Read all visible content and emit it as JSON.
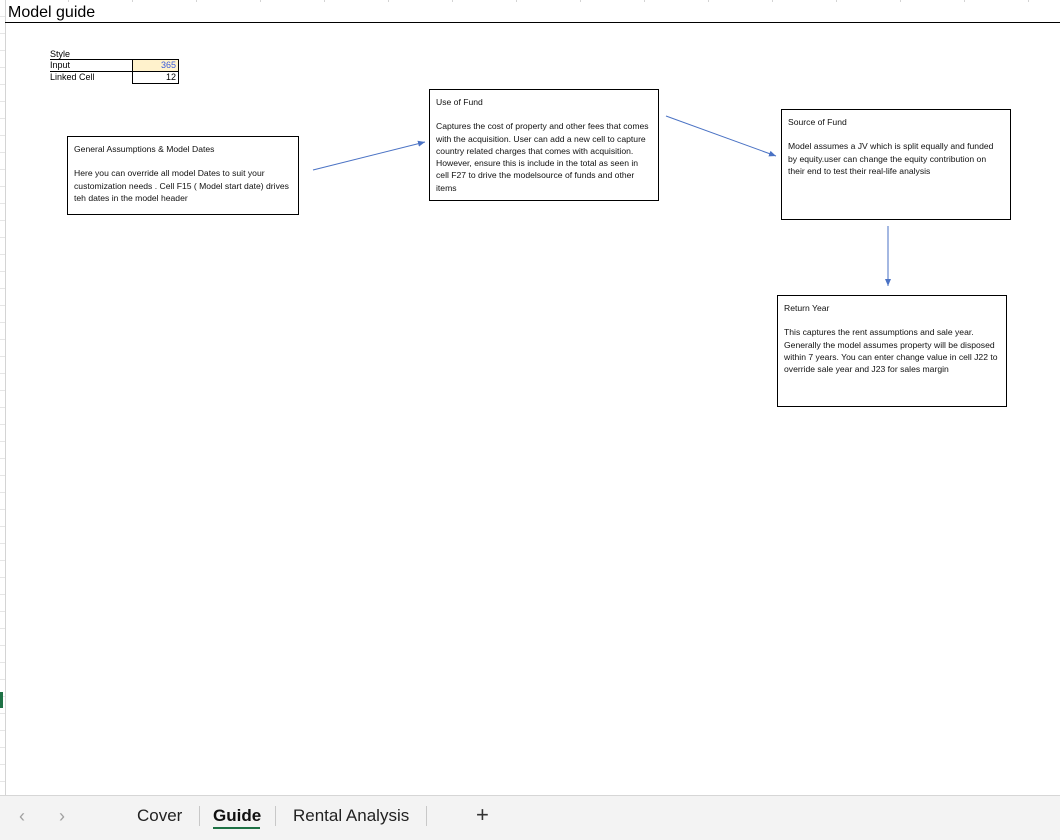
{
  "sheet_title": "Model guide",
  "style_block": {
    "heading": "Style",
    "rows": [
      {
        "label": "Input",
        "value": "365"
      },
      {
        "label": "Linked Cell",
        "value": "12"
      }
    ]
  },
  "boxes": {
    "general": {
      "title": "General Assumptions & Model Dates",
      "body": "Here you can override all model Dates to suit your customization needs . Cell F15 ( Model start date) drives teh dates in the model header"
    },
    "use_of_fund": {
      "title": "Use of Fund",
      "body": "Captures the cost of property and other fees that comes with the acquisition. User can add a new cell to capture country related charges that comes with acquisition. However, ensure this is include in the total as  seen in cell F27 to drive the modelsource of funds and other items"
    },
    "source_of_fund": {
      "title": "Source of Fund",
      "body": "Model assumes a JV which is split equally and funded by equity.user can change the equity contribution on their end to test their real-life analysis"
    },
    "return_year": {
      "title": "Return Year",
      "body": "This captures the rent assumptions and sale year. Generally the model assumes property will be disposed within 7 years. You can enter change value in cell J22 to override sale year and J23 for sales margin"
    }
  },
  "tabs": {
    "prev_icon": "chevron-left-icon",
    "next_icon": "chevron-right-icon",
    "items": [
      {
        "label": "Cover",
        "active": false
      },
      {
        "label": "Guide",
        "active": true
      },
      {
        "label": "Rental Analysis",
        "active": false
      }
    ],
    "add_label": "+"
  },
  "colors": {
    "arrow": "#4a72c4",
    "input_fill": "#fff2cc",
    "input_text": "#3b5bdb",
    "active_tab_underline": "#1e7145"
  }
}
